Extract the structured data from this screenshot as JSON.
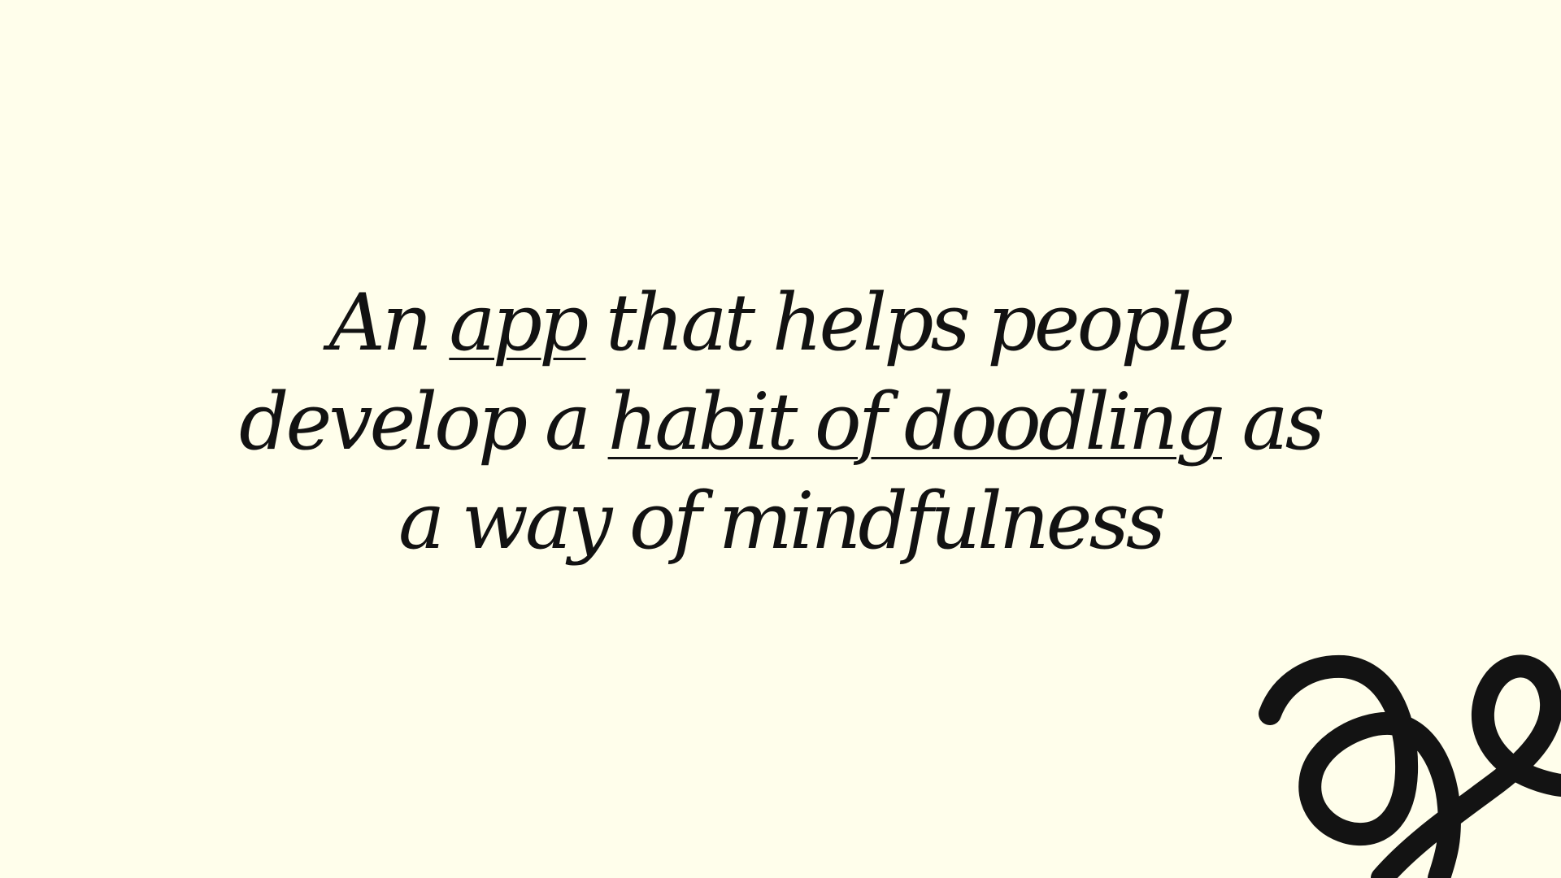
{
  "slide": {
    "lines": [
      {
        "segments": [
          {
            "text": "An ",
            "underline": false
          },
          {
            "text": "app",
            "underline": true
          },
          {
            "text": " that helps people",
            "underline": false
          }
        ]
      },
      {
        "segments": [
          {
            "text": "develop a ",
            "underline": false
          },
          {
            "text": "habit of doodling",
            "underline": true
          },
          {
            "text": " as",
            "underline": false
          }
        ]
      },
      {
        "segments": [
          {
            "text": "a way of mindfulness",
            "underline": false
          }
        ]
      }
    ]
  },
  "colors": {
    "background": "#FFFEEB",
    "text": "#121212",
    "doodle": "#131313"
  },
  "decoration": {
    "icon": "squiggle-doodle-icon"
  }
}
